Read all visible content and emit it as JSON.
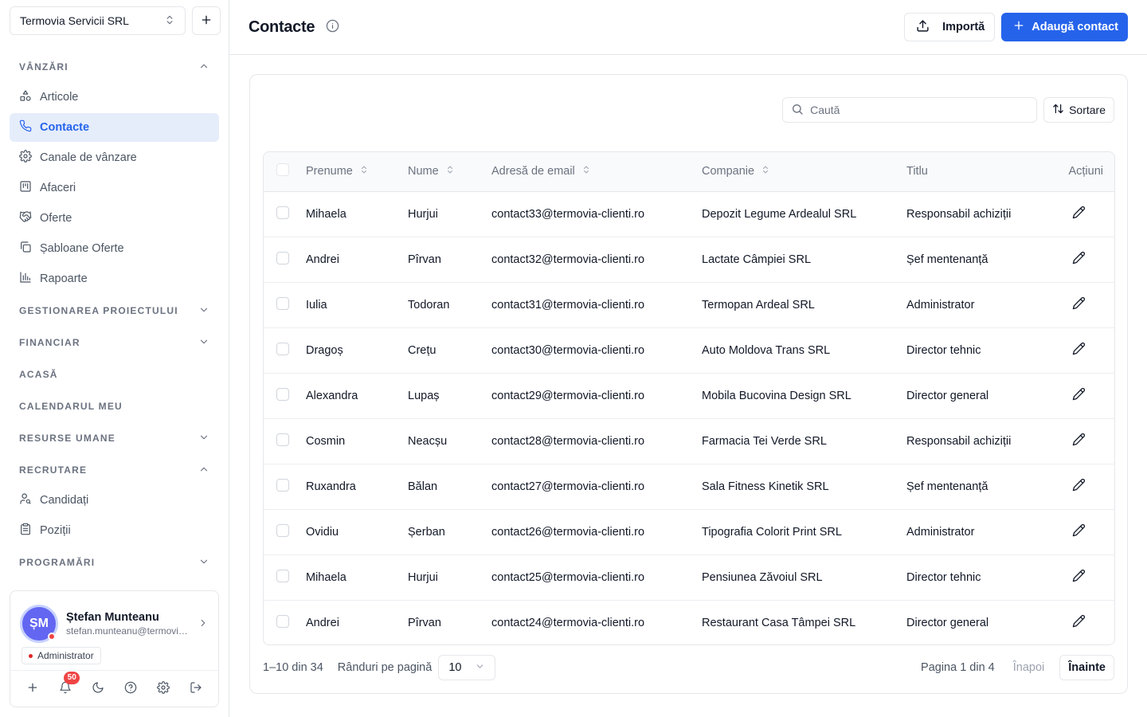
{
  "sidebar": {
    "org_name": "Termovia Servicii SRL",
    "sections": {
      "vanzari": "VÂNZĂRI",
      "proiect": "GESTIONAREA PROIECTULUI",
      "financiar": "FINANCIAR",
      "acasa": "ACASĂ",
      "calendar": "CALENDARUL MEU",
      "resurse": "RESURSE UMANE",
      "recrutare": "RECRUTARE",
      "programari": "PROGRAMĂRI"
    },
    "sales_items": [
      {
        "label": "Articole",
        "icon": "shapes-icon"
      },
      {
        "label": "Contacte",
        "icon": "phone-icon"
      },
      {
        "label": "Canale de vânzare",
        "icon": "gear-icon"
      },
      {
        "label": "Afaceri",
        "icon": "kanban-icon"
      },
      {
        "label": "Oferte",
        "icon": "handshake-icon"
      },
      {
        "label": "Șabloane Oferte",
        "icon": "copy-icon"
      },
      {
        "label": "Rapoarte",
        "icon": "bar-chart-icon"
      }
    ],
    "recruit_items": [
      {
        "label": "Candidați",
        "icon": "user-search-icon"
      },
      {
        "label": "Poziții",
        "icon": "clipboard-icon"
      }
    ],
    "user": {
      "initials": "ȘM",
      "name": "Ștefan Munteanu",
      "email": "stefan.munteanu@termovia-servicii.ro",
      "role": "Administrator",
      "notifications": "50"
    }
  },
  "header": {
    "title": "Contacte",
    "import_label": "Importă",
    "add_label": "Adaugă contact"
  },
  "toolbar": {
    "search_placeholder": "Caută",
    "sort_label": "Sortare"
  },
  "table": {
    "columns": {
      "first": "Prenume",
      "last": "Nume",
      "email": "Adresă de email",
      "company": "Companie",
      "title": "Titlu",
      "actions": "Acțiuni"
    },
    "rows": [
      {
        "first": "Mihaela",
        "last": "Hurjui",
        "email": "contact33@termovia-clienti.ro",
        "company": "Depozit Legume Ardealul SRL",
        "title": "Responsabil achiziții"
      },
      {
        "first": "Andrei",
        "last": "Pîrvan",
        "email": "contact32@termovia-clienti.ro",
        "company": "Lactate Câmpiei SRL",
        "title": "Șef mentenanță"
      },
      {
        "first": "Iulia",
        "last": "Todoran",
        "email": "contact31@termovia-clienti.ro",
        "company": "Termopan Ardeal SRL",
        "title": "Administrator"
      },
      {
        "first": "Dragoș",
        "last": "Crețu",
        "email": "contact30@termovia-clienti.ro",
        "company": "Auto Moldova Trans SRL",
        "title": "Director tehnic"
      },
      {
        "first": "Alexandra",
        "last": "Lupaș",
        "email": "contact29@termovia-clienti.ro",
        "company": "Mobila Bucovina Design SRL",
        "title": "Director general"
      },
      {
        "first": "Cosmin",
        "last": "Neacșu",
        "email": "contact28@termovia-clienti.ro",
        "company": "Farmacia Tei Verde SRL",
        "title": "Responsabil achiziții"
      },
      {
        "first": "Ruxandra",
        "last": "Bălan",
        "email": "contact27@termovia-clienti.ro",
        "company": "Sala Fitness Kinetik SRL",
        "title": "Șef mentenanță"
      },
      {
        "first": "Ovidiu",
        "last": "Șerban",
        "email": "contact26@termovia-clienti.ro",
        "company": "Tipografia Colorit Print SRL",
        "title": "Administrator"
      },
      {
        "first": "Mihaela",
        "last": "Hurjui",
        "email": "contact25@termovia-clienti.ro",
        "company": "Pensiunea Zăvoiul SRL",
        "title": "Director tehnic"
      },
      {
        "first": "Andrei",
        "last": "Pîrvan",
        "email": "contact24@termovia-clienti.ro",
        "company": "Restaurant Casa Tâmpei SRL",
        "title": "Director general"
      }
    ]
  },
  "pagination": {
    "range": "1–10 din 34",
    "rows_label": "Rânduri pe pagină",
    "rows_value": "10",
    "page_info": "Pagina 1 din 4",
    "prev": "Înapoi",
    "next": "Înainte"
  },
  "colors": {
    "accent": "#2563eb",
    "active_bg": "#e5edfb",
    "danger": "#ef4444"
  }
}
